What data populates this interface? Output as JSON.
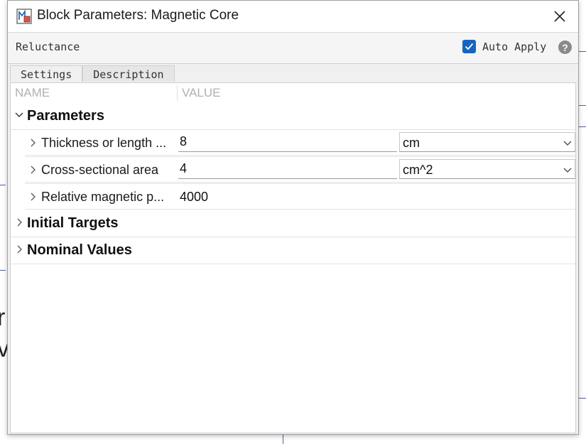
{
  "window": {
    "title": "Block Parameters: Magnetic Core",
    "block_name": "Reluctance",
    "auto_apply_label": "Auto Apply",
    "auto_apply_checked": true,
    "help_symbol": "?"
  },
  "tabs": [
    {
      "label": "Settings",
      "active": true
    },
    {
      "label": "Description",
      "active": false
    }
  ],
  "columns": {
    "name": "NAME",
    "value": "VALUE"
  },
  "sections": {
    "parameters": {
      "label": "Parameters",
      "expanded": true
    },
    "initial_targets": {
      "label": "Initial Targets",
      "expanded": false
    },
    "nominal_values": {
      "label": "Nominal Values",
      "expanded": false
    }
  },
  "params": [
    {
      "name": "Thickness or length ...",
      "value": "8",
      "unit": "cm"
    },
    {
      "name": "Cross-sectional area",
      "value": "4",
      "unit": "cm^2"
    },
    {
      "name": "Relative magnetic p...",
      "value": "4000"
    }
  ],
  "background_text": [
    "r",
    "v"
  ],
  "colors": {
    "accent": "#1565c0",
    "bg_wire": "#4a5fa8"
  },
  "icons": {
    "app": "block-parameters-icon",
    "close": "close-icon",
    "check": "checkmark-icon",
    "help": "help-icon",
    "expand": "chevron-right-icon",
    "collapse": "chevron-down-icon",
    "dropdown": "dropdown-arrow-icon"
  }
}
